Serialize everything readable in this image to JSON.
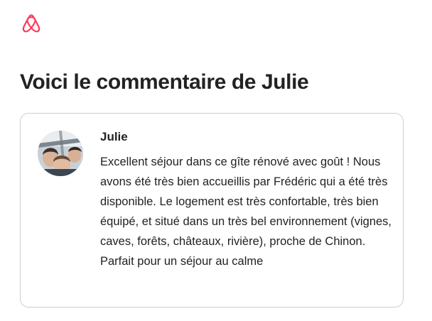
{
  "brand": {
    "logo_icon": "airbnb-logo-icon",
    "accent_color": "#FF385C"
  },
  "page": {
    "title": "Voici le commentaire de Julie"
  },
  "review": {
    "avatar_icon": "user-photo-avatar",
    "author": "Julie",
    "text": "Excellent séjour dans ce gîte rénové avec goût ! Nous avons été très bien accueillis par Frédéric qui a été très disponible. Le logement est très confortable, très bien équipé, et situé dans un très bel environnement (vignes, caves, forêts, châteaux, rivière), proche de Chinon. Parfait pour un séjour au calme"
  }
}
